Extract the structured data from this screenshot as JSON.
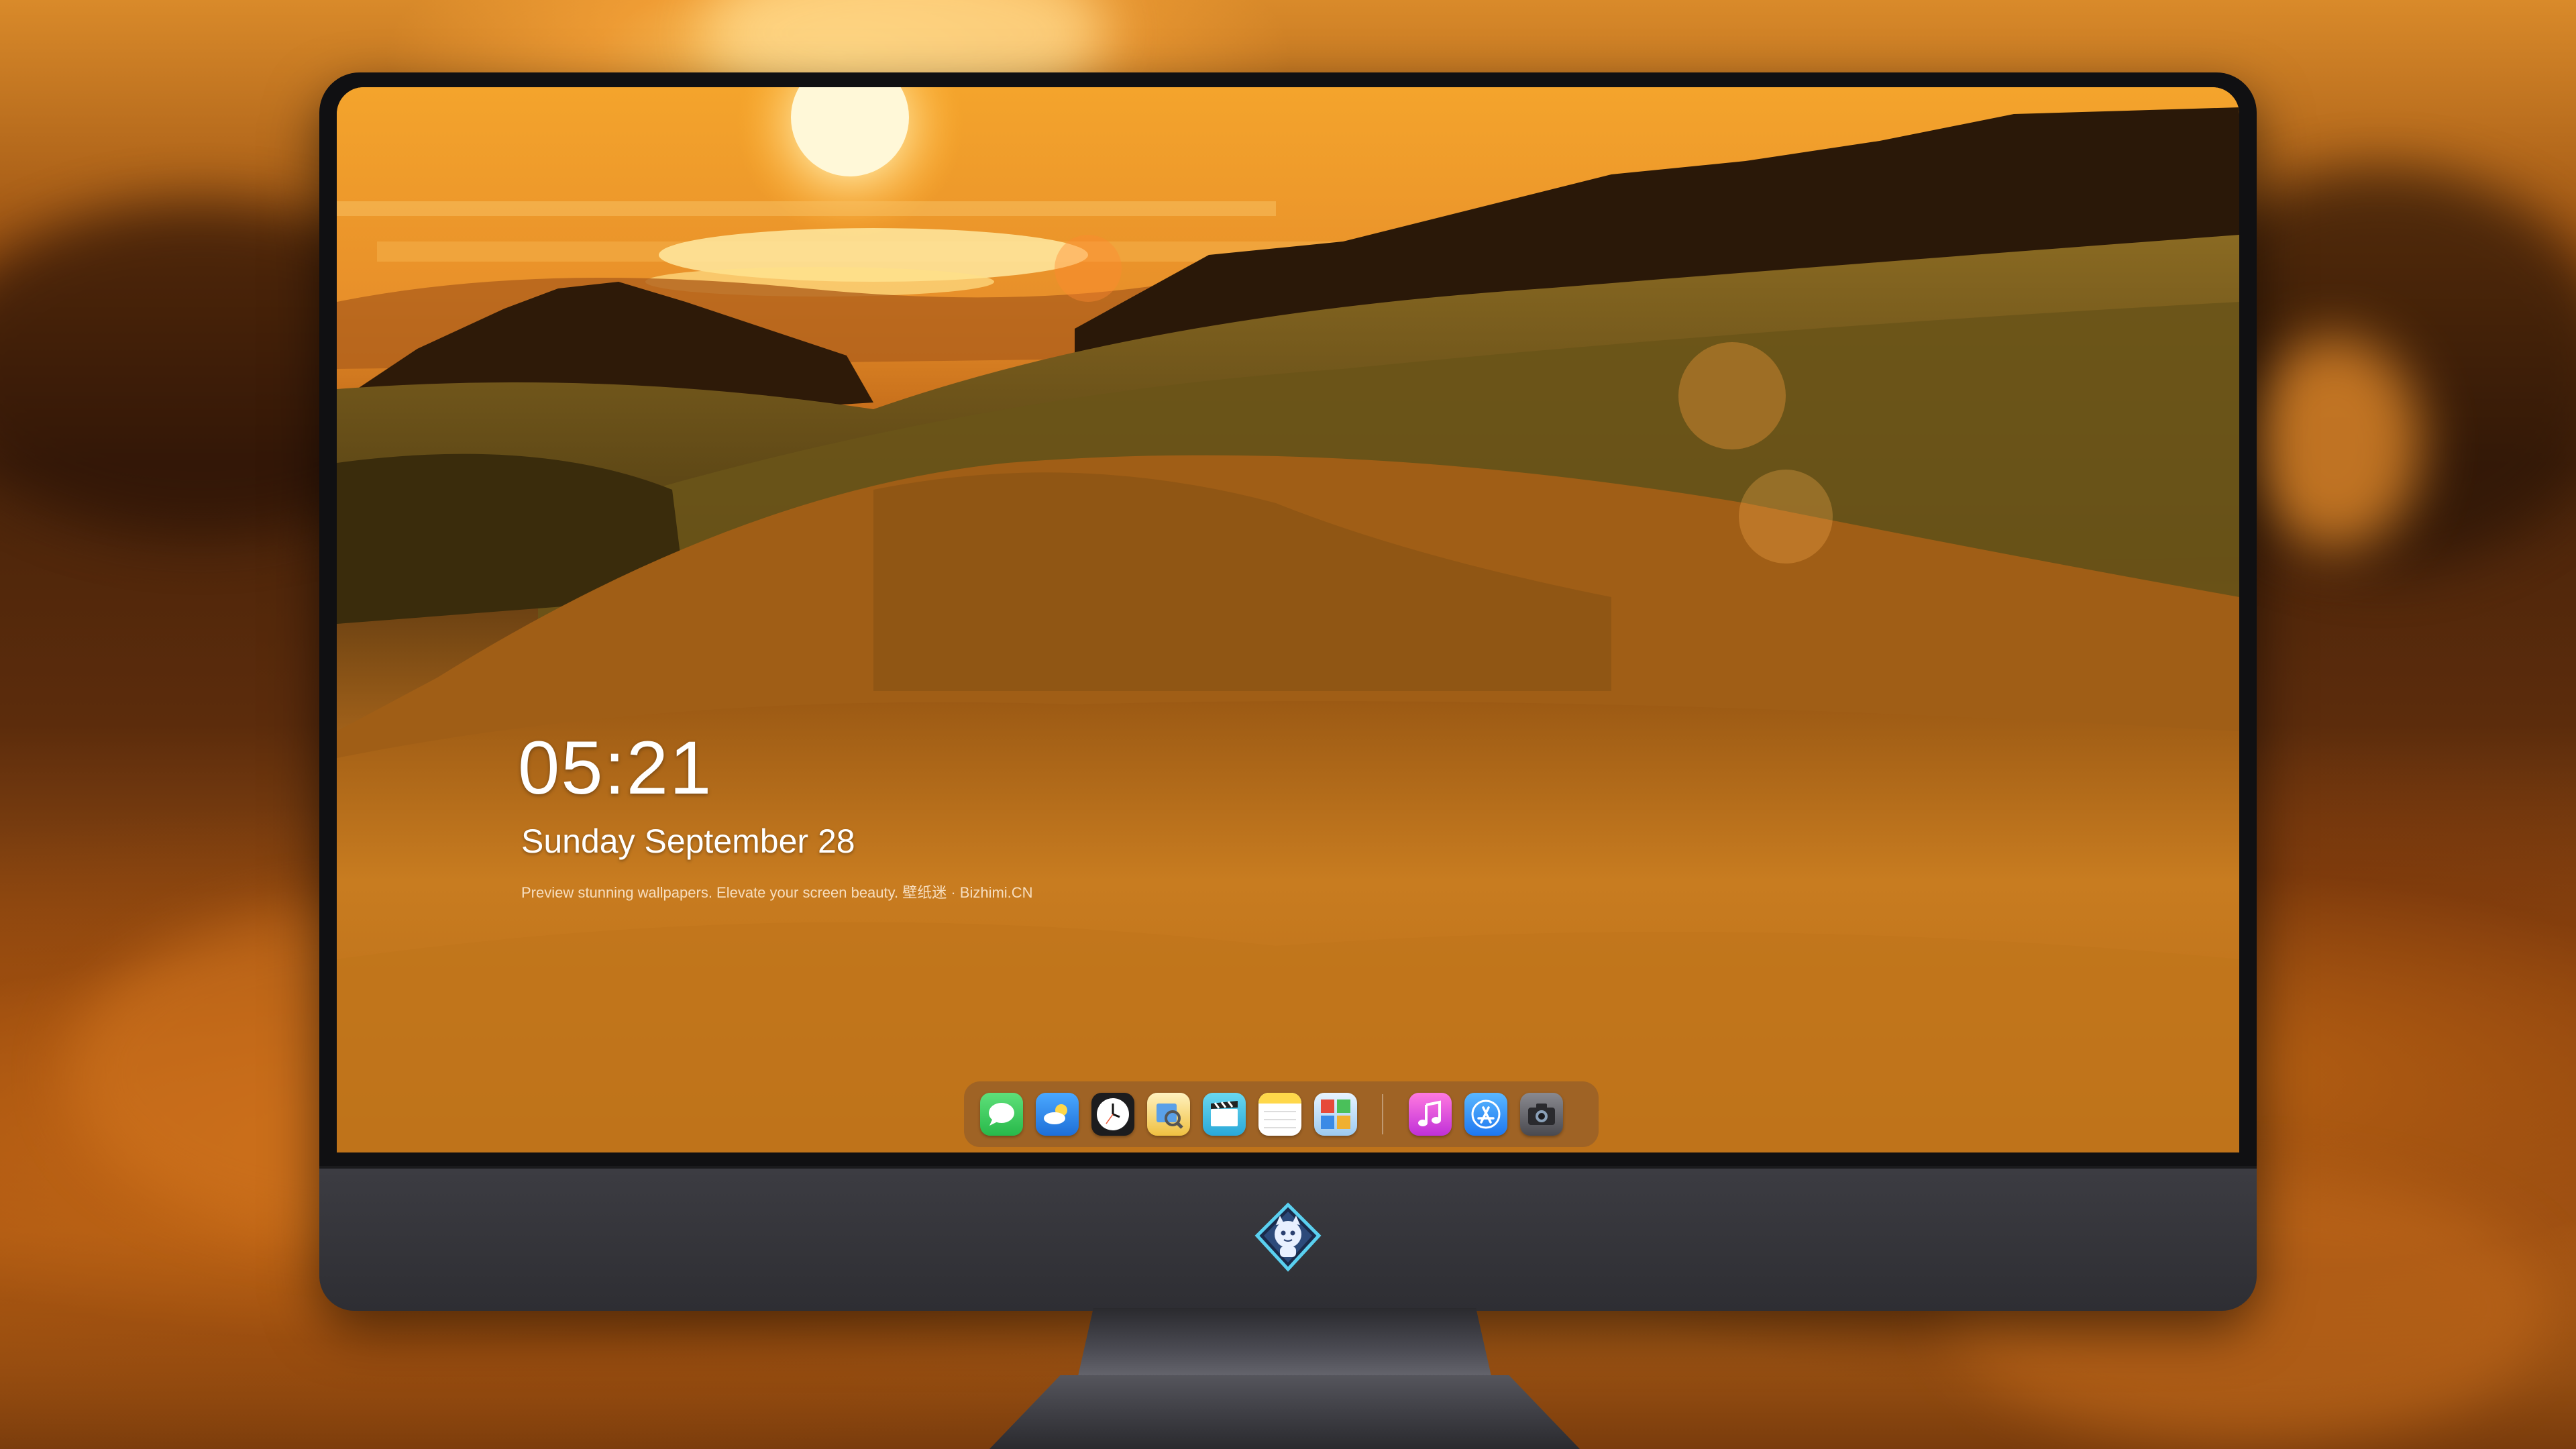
{
  "lockscreen": {
    "time": "05:21",
    "date": "Sunday September  28",
    "tagline": "Preview stunning wallpapers. Elevate your screen beauty. 壁纸迷 · Bizhimi.CN"
  },
  "dock": {
    "apps": [
      {
        "name": "Messages",
        "icon": "messages-icon",
        "color": "#34c759"
      },
      {
        "name": "Weather",
        "icon": "weather-icon",
        "color": "#2f8cf0"
      },
      {
        "name": "Clock",
        "icon": "clock-icon",
        "color": "#1c1c1e"
      },
      {
        "name": "Preview",
        "icon": "preview-icon",
        "color": "#f0c040"
      },
      {
        "name": "Clips",
        "icon": "clips-icon",
        "color": "#3cc8e8"
      },
      {
        "name": "Notes",
        "icon": "notes-icon",
        "color": "#ffd84a"
      },
      {
        "name": "Photo Booth",
        "icon": "photo-booth-icon",
        "color": "#5aa8e0"
      },
      {
        "name": "Music",
        "icon": "music-icon",
        "color": "#e040c8"
      },
      {
        "name": "App Store",
        "icon": "app-store-icon",
        "color": "#1e90ff"
      },
      {
        "name": "Camera",
        "icon": "camera-icon",
        "color": "#6a6a6e"
      }
    ]
  },
  "monitor": {
    "logo": "mascot-logo",
    "bezel_color": "#101012",
    "chin_color": "#35353a"
  }
}
